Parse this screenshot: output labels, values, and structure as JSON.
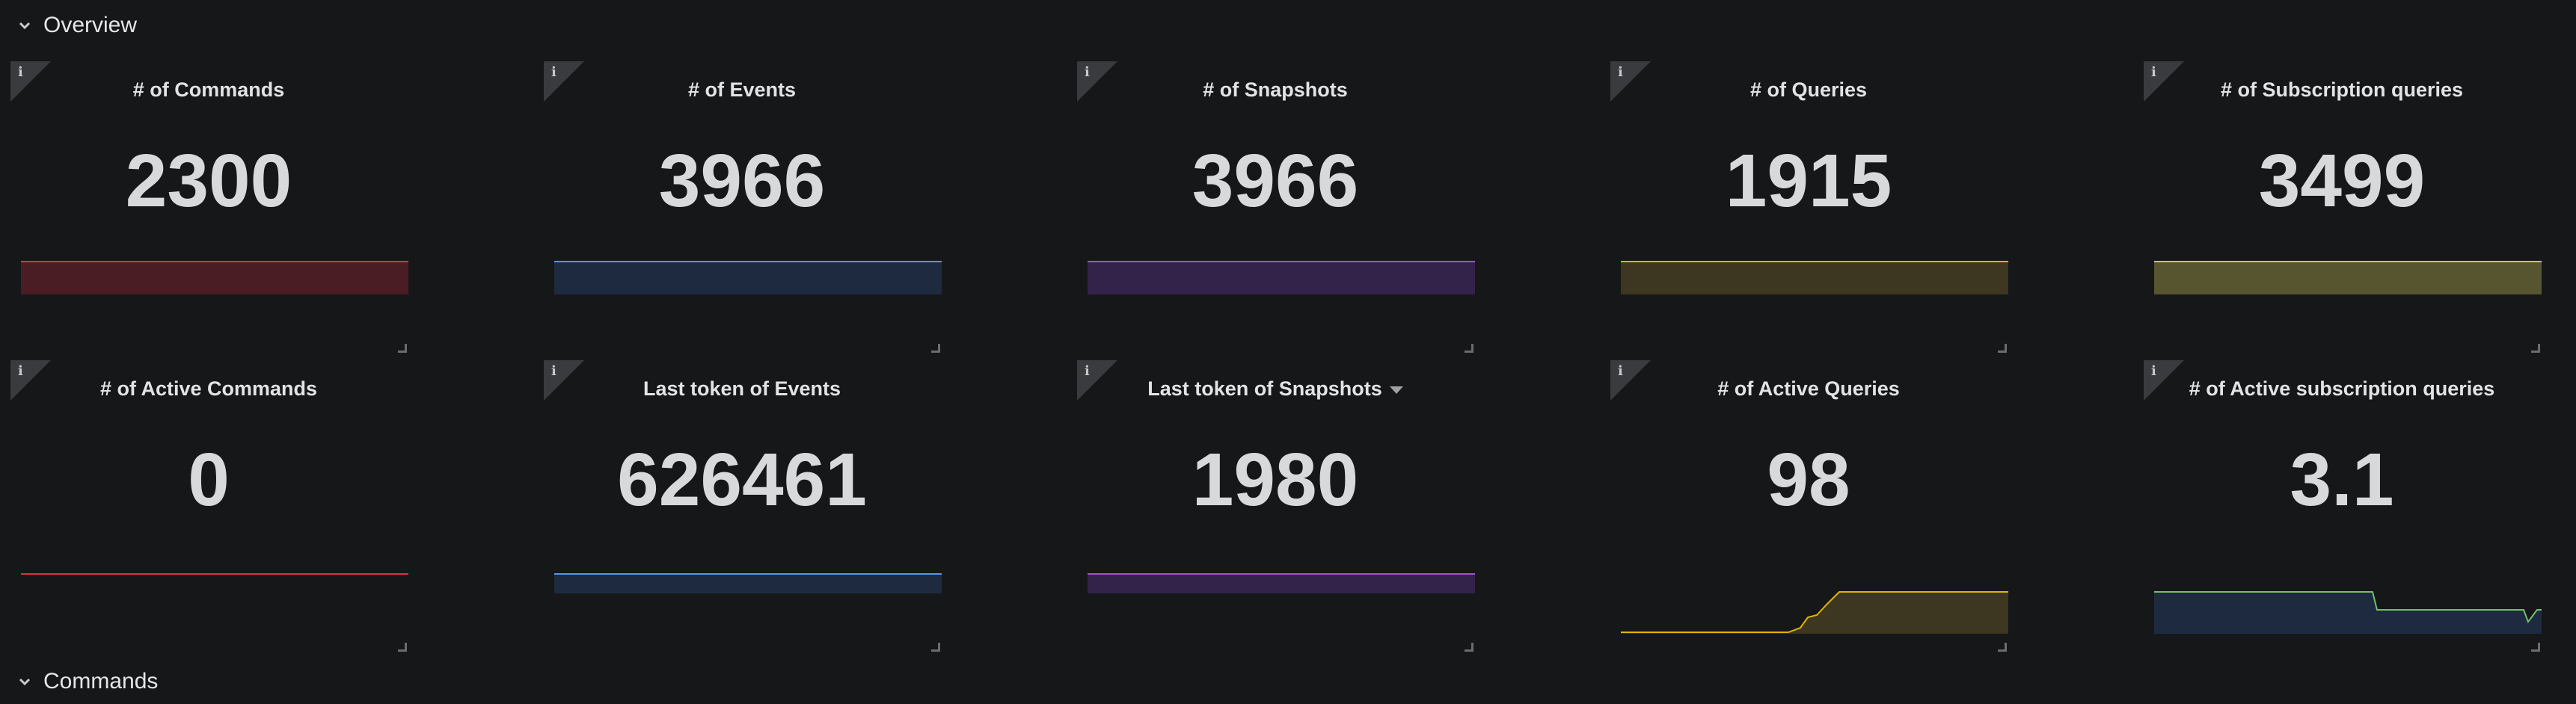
{
  "rows": [
    {
      "title": "Overview"
    },
    {
      "title": "Commands"
    }
  ],
  "panels": [
    {
      "title": "# of Commands",
      "value": "2300",
      "color": "#e02f44",
      "fill": "#4a1c24"
    },
    {
      "title": "# of Events",
      "value": "3966",
      "color": "#5794f2",
      "fill": "#1e2a3f"
    },
    {
      "title": "# of Snapshots",
      "value": "3966",
      "color": "#a352cc",
      "fill": "#33234a"
    },
    {
      "title": "# of Queries",
      "value": "1915",
      "color": "#e0b400",
      "fill": "#3d3621"
    },
    {
      "title": "# of Subscription queries",
      "value": "3499",
      "color": "#cbd024",
      "fill": "#56552f"
    },
    {
      "title": "# of Active Commands",
      "value": "0",
      "color": "#e02f44",
      "fill": "#161719"
    },
    {
      "title": "Last token of Events",
      "value": "626461",
      "color": "#5794f2",
      "fill": "#1e2a3f"
    },
    {
      "title": "Last token of Snapshots",
      "value": "1980",
      "color": "#a352cc",
      "fill": "#33234a",
      "has_menu": true
    },
    {
      "title": "# of Active Queries",
      "value": "98",
      "color": "#e0b400",
      "fill": "#3d3621"
    },
    {
      "title": "# of Active subscription queries",
      "value": "3.1",
      "color": "#73bf69",
      "fill": "#1e2a3f"
    }
  ],
  "icons": {
    "info": "info-icon",
    "collapse": "chevron-down-icon",
    "menu": "caret-down-icon",
    "resize": "resize-handle-icon"
  }
}
